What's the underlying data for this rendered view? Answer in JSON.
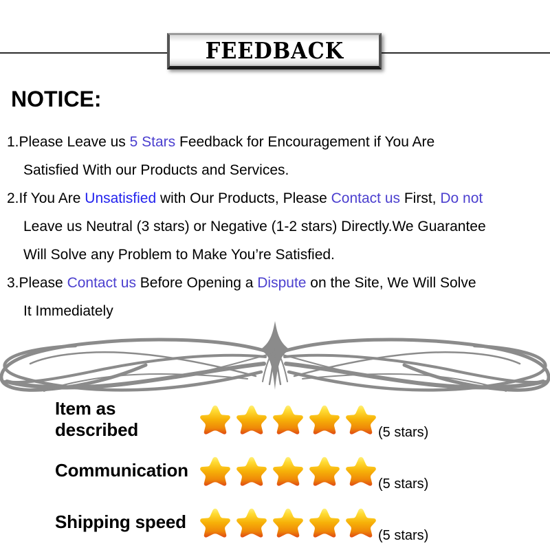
{
  "banner": {
    "title": "FEEDBACK"
  },
  "notice": {
    "heading": "NOTICE:",
    "items": [
      {
        "number": "1.",
        "lines": [
          [
            {
              "text": "Please Leave us  ",
              "style": "plain"
            },
            {
              "text": "5 Stars",
              "style": "violet"
            },
            {
              "text": "  Feedback for  Encouragement  if You Are",
              "style": "plain"
            }
          ],
          [
            {
              "text": "Satisfied With our Products and Services.",
              "style": "plain"
            }
          ]
        ]
      },
      {
        "number": "2.",
        "lines": [
          [
            {
              "text": "If You Are ",
              "style": "plain"
            },
            {
              "text": "Unsatisfied",
              "style": "blue"
            },
            {
              "text": " with Our Products, Please ",
              "style": "plain"
            },
            {
              "text": "Contact us",
              "style": "violet"
            },
            {
              "text": " First, ",
              "style": "plain"
            },
            {
              "text": "Do not",
              "style": "violet"
            }
          ],
          [
            {
              "text": "Leave us Neutral (3 stars) or Negative (1-2 stars) Directly.We Guarantee",
              "style": "plain"
            }
          ],
          [
            {
              "text": "Will Solve any Problem to Make You’re  Satisfied.",
              "style": "plain"
            }
          ]
        ]
      },
      {
        "number": "3.",
        "lines": [
          [
            {
              "text": "Please ",
              "style": "plain"
            },
            {
              "text": "Contact us",
              "style": "violet"
            },
            {
              "text": " Before Opening a ",
              "style": "plain"
            },
            {
              "text": "Dispute",
              "style": "violet"
            },
            {
              "text": " on the Site, We Will Solve",
              "style": "plain"
            }
          ],
          [
            {
              "text": "It Immediately",
              "style": "plain"
            }
          ]
        ]
      }
    ]
  },
  "ratings": {
    "rows": [
      {
        "label": "Item as described",
        "stars": 5,
        "count_label": "(5 stars)"
      },
      {
        "label": "Communication",
        "stars": 5,
        "count_label": "(5 stars)"
      },
      {
        "label": "Shipping speed",
        "stars": 5,
        "count_label": "(5 stars)"
      }
    ]
  },
  "colors": {
    "accent_violet": "#4b3fcf",
    "accent_blue": "#2222ee",
    "star_top": "#ffe44d",
    "star_mid": "#f5a906",
    "star_bottom": "#e2511a",
    "ornament": "#8b8b8b",
    "rule": "#2b2b2b"
  }
}
